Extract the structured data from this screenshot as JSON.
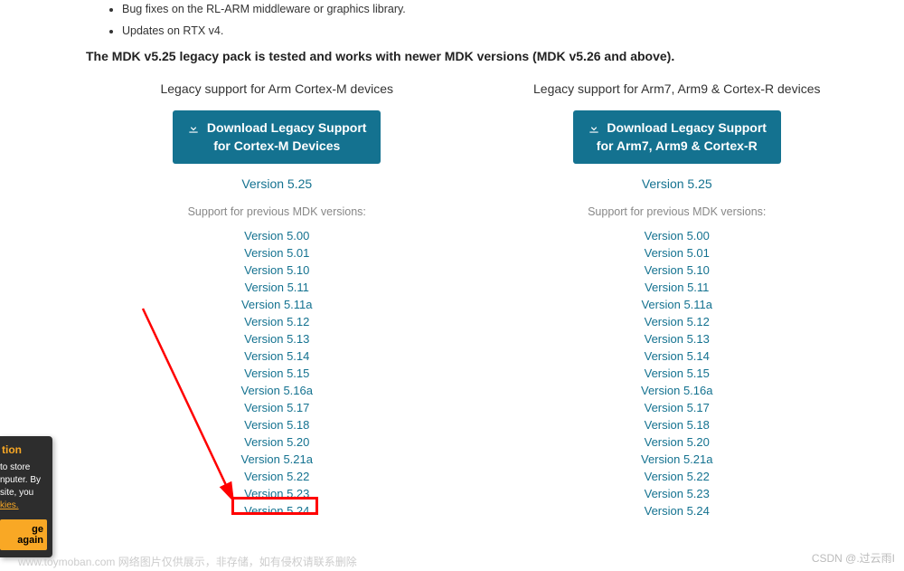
{
  "bullets": [
    "Bug fixes on the RL-ARM middleware or graphics library.",
    "Updates on RTX v4."
  ],
  "tested_note": "The MDK v5.25 legacy pack is tested and works with newer MDK versions (MDK v5.26 and above).",
  "columns": [
    {
      "title": "Legacy support for Arm Cortex-M devices",
      "dl_line1": "Download Legacy Support",
      "dl_line2": "for Cortex-M Devices",
      "main_version": "Version 5.25",
      "prev_label": "Support for previous MDK versions:"
    },
    {
      "title": "Legacy support for Arm7, Arm9 & Cortex-R devices",
      "dl_line1": "Download Legacy Support",
      "dl_line2": "for Arm7, Arm9 & Cortex-R",
      "main_version": "Version 5.25",
      "prev_label": "Support for previous MDK versions:"
    }
  ],
  "versions": [
    "Version 5.00",
    "Version 5.01",
    "Version 5.10",
    "Version 5.11",
    "Version 5.11a",
    "Version 5.12",
    "Version 5.13",
    "Version 5.14",
    "Version 5.15",
    "Version 5.16a",
    "Version 5.17",
    "Version 5.18",
    "Version 5.20",
    "Version 5.21a",
    "Version 5.22",
    "Version 5.23",
    "Version 5.24"
  ],
  "cookie": {
    "title": "tion",
    "line1": "to store",
    "line2": "nputer. By",
    "line3": "site, you",
    "link": "kies.",
    "btn": "ge again"
  },
  "footer": "www.toymoban.com  网络图片仅供展示，非存储，如有侵权请联系删除",
  "watermark": "CSDN @.过云雨I"
}
